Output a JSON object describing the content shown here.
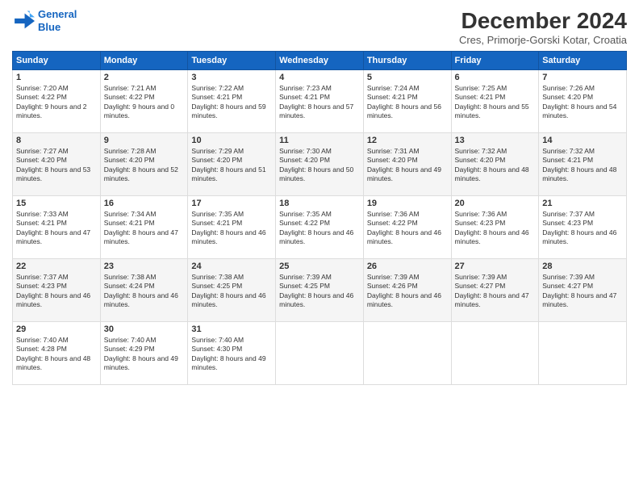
{
  "logo": {
    "line1": "General",
    "line2": "Blue"
  },
  "title": "December 2024",
  "location": "Cres, Primorje-Gorski Kotar, Croatia",
  "days_of_week": [
    "Sunday",
    "Monday",
    "Tuesday",
    "Wednesday",
    "Thursday",
    "Friday",
    "Saturday"
  ],
  "weeks": [
    [
      {
        "day": "1",
        "sunrise": "7:20 AM",
        "sunset": "4:22 PM",
        "daylight": "9 hours and 2 minutes."
      },
      {
        "day": "2",
        "sunrise": "7:21 AM",
        "sunset": "4:22 PM",
        "daylight": "9 hours and 0 minutes."
      },
      {
        "day": "3",
        "sunrise": "7:22 AM",
        "sunset": "4:21 PM",
        "daylight": "8 hours and 59 minutes."
      },
      {
        "day": "4",
        "sunrise": "7:23 AM",
        "sunset": "4:21 PM",
        "daylight": "8 hours and 57 minutes."
      },
      {
        "day": "5",
        "sunrise": "7:24 AM",
        "sunset": "4:21 PM",
        "daylight": "8 hours and 56 minutes."
      },
      {
        "day": "6",
        "sunrise": "7:25 AM",
        "sunset": "4:21 PM",
        "daylight": "8 hours and 55 minutes."
      },
      {
        "day": "7",
        "sunrise": "7:26 AM",
        "sunset": "4:20 PM",
        "daylight": "8 hours and 54 minutes."
      }
    ],
    [
      {
        "day": "8",
        "sunrise": "7:27 AM",
        "sunset": "4:20 PM",
        "daylight": "8 hours and 53 minutes."
      },
      {
        "day": "9",
        "sunrise": "7:28 AM",
        "sunset": "4:20 PM",
        "daylight": "8 hours and 52 minutes."
      },
      {
        "day": "10",
        "sunrise": "7:29 AM",
        "sunset": "4:20 PM",
        "daylight": "8 hours and 51 minutes."
      },
      {
        "day": "11",
        "sunrise": "7:30 AM",
        "sunset": "4:20 PM",
        "daylight": "8 hours and 50 minutes."
      },
      {
        "day": "12",
        "sunrise": "7:31 AM",
        "sunset": "4:20 PM",
        "daylight": "8 hours and 49 minutes."
      },
      {
        "day": "13",
        "sunrise": "7:32 AM",
        "sunset": "4:20 PM",
        "daylight": "8 hours and 48 minutes."
      },
      {
        "day": "14",
        "sunrise": "7:32 AM",
        "sunset": "4:21 PM",
        "daylight": "8 hours and 48 minutes."
      }
    ],
    [
      {
        "day": "15",
        "sunrise": "7:33 AM",
        "sunset": "4:21 PM",
        "daylight": "8 hours and 47 minutes."
      },
      {
        "day": "16",
        "sunrise": "7:34 AM",
        "sunset": "4:21 PM",
        "daylight": "8 hours and 47 minutes."
      },
      {
        "day": "17",
        "sunrise": "7:35 AM",
        "sunset": "4:21 PM",
        "daylight": "8 hours and 46 minutes."
      },
      {
        "day": "18",
        "sunrise": "7:35 AM",
        "sunset": "4:22 PM",
        "daylight": "8 hours and 46 minutes."
      },
      {
        "day": "19",
        "sunrise": "7:36 AM",
        "sunset": "4:22 PM",
        "daylight": "8 hours and 46 minutes."
      },
      {
        "day": "20",
        "sunrise": "7:36 AM",
        "sunset": "4:23 PM",
        "daylight": "8 hours and 46 minutes."
      },
      {
        "day": "21",
        "sunrise": "7:37 AM",
        "sunset": "4:23 PM",
        "daylight": "8 hours and 46 minutes."
      }
    ],
    [
      {
        "day": "22",
        "sunrise": "7:37 AM",
        "sunset": "4:23 PM",
        "daylight": "8 hours and 46 minutes."
      },
      {
        "day": "23",
        "sunrise": "7:38 AM",
        "sunset": "4:24 PM",
        "daylight": "8 hours and 46 minutes."
      },
      {
        "day": "24",
        "sunrise": "7:38 AM",
        "sunset": "4:25 PM",
        "daylight": "8 hours and 46 minutes."
      },
      {
        "day": "25",
        "sunrise": "7:39 AM",
        "sunset": "4:25 PM",
        "daylight": "8 hours and 46 minutes."
      },
      {
        "day": "26",
        "sunrise": "7:39 AM",
        "sunset": "4:26 PM",
        "daylight": "8 hours and 46 minutes."
      },
      {
        "day": "27",
        "sunrise": "7:39 AM",
        "sunset": "4:27 PM",
        "daylight": "8 hours and 47 minutes."
      },
      {
        "day": "28",
        "sunrise": "7:39 AM",
        "sunset": "4:27 PM",
        "daylight": "8 hours and 47 minutes."
      }
    ],
    [
      {
        "day": "29",
        "sunrise": "7:40 AM",
        "sunset": "4:28 PM",
        "daylight": "8 hours and 48 minutes."
      },
      {
        "day": "30",
        "sunrise": "7:40 AM",
        "sunset": "4:29 PM",
        "daylight": "8 hours and 49 minutes."
      },
      {
        "day": "31",
        "sunrise": "7:40 AM",
        "sunset": "4:30 PM",
        "daylight": "8 hours and 49 minutes."
      },
      null,
      null,
      null,
      null
    ]
  ],
  "labels": {
    "sunrise": "Sunrise:",
    "sunset": "Sunset:",
    "daylight": "Daylight:"
  }
}
